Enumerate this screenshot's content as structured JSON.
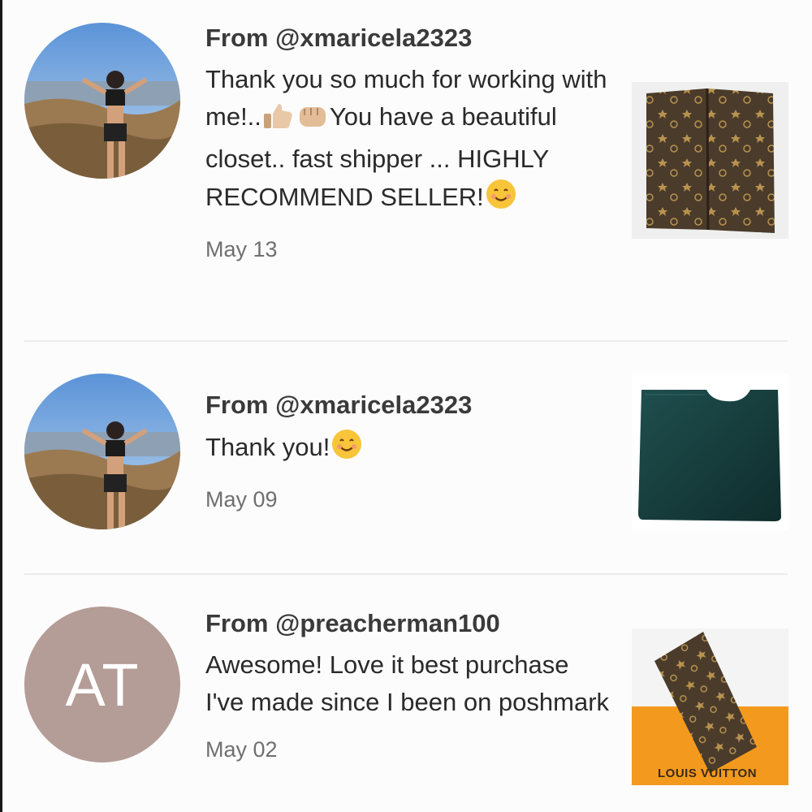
{
  "feedback": [
    {
      "from": "From @xmaricela2323",
      "message_parts": [
        "Thank you so much for working with me!..",
        "You have a beautiful closet.. fast shipper ... HIGHLY RECOMMEND SELLER!"
      ],
      "date": "May 13",
      "avatar": "photo-avatar",
      "item": "monogram-wallet-thumbnail"
    },
    {
      "from": "From @xmaricela2323",
      "message": "Thank you!",
      "date": "May 09",
      "avatar": "photo-avatar",
      "item": "leather-sleeve-thumbnail"
    },
    {
      "from": "From @preacherman100",
      "message": "Awesome! Love it best purchase I've made since I been on poshmark",
      "date": "May 02",
      "avatar_initials": "AT",
      "item": "monogram-checkbook-thumbnail",
      "item_box_text": "LOUIS VUITTON"
    }
  ],
  "colors": {
    "initials_avatar": "#b49c97",
    "divider": "#ececec",
    "date_text": "#6f6f6f"
  }
}
